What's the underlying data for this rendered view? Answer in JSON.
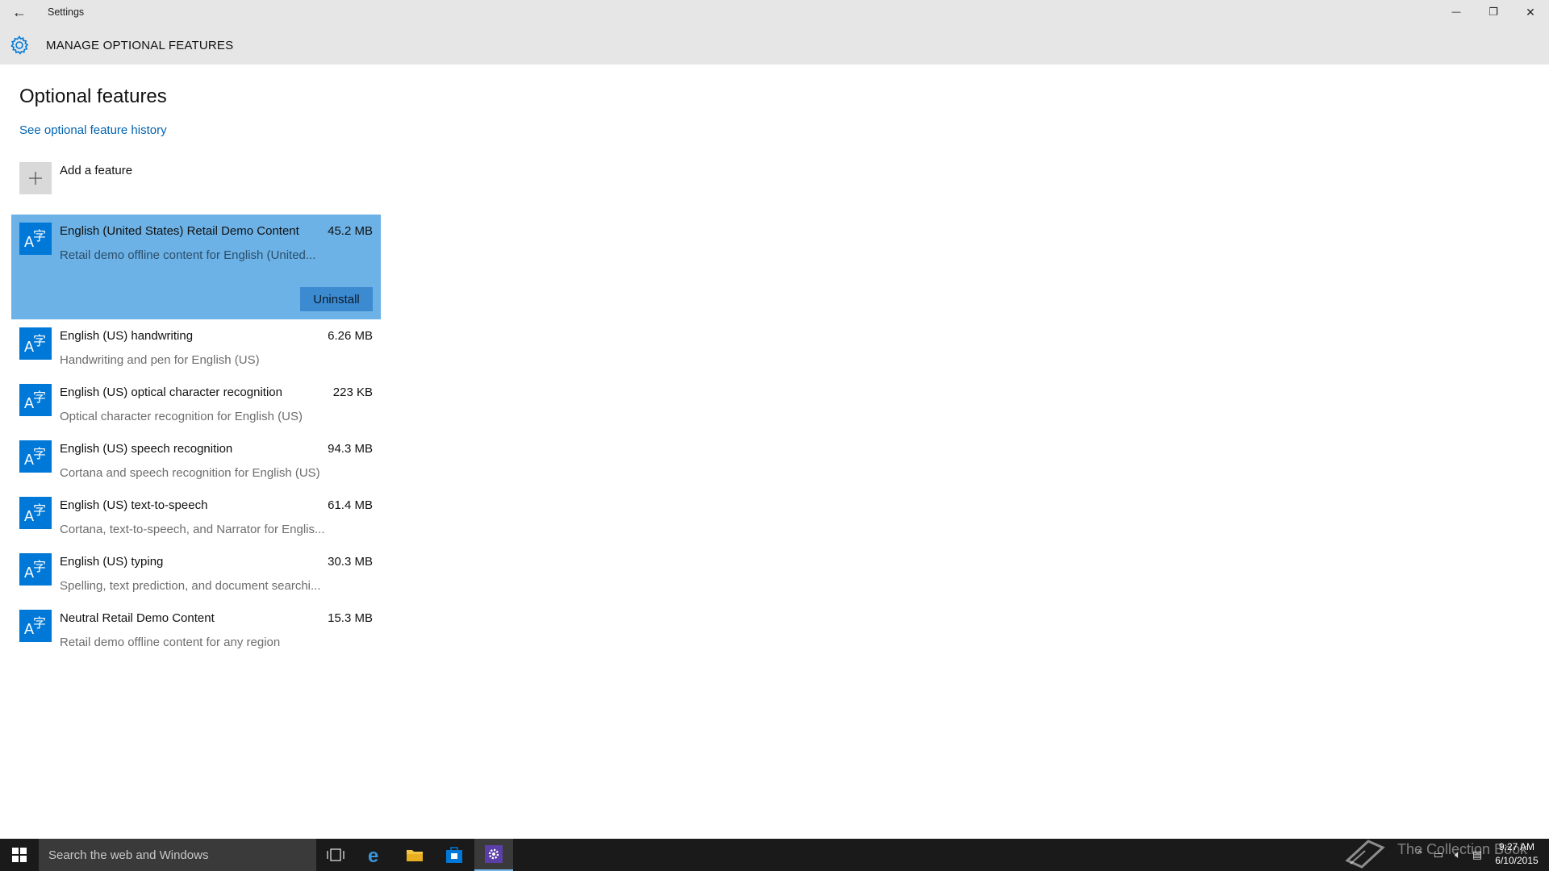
{
  "window": {
    "title": "Settings",
    "back_glyph": "←",
    "minimize_glyph": "—",
    "maximize_glyph": "❐",
    "close_glyph": "✕"
  },
  "header": {
    "title": "MANAGE OPTIONAL FEATURES",
    "icon": "gear-icon",
    "icon_color": "#0078d7"
  },
  "main": {
    "heading": "Optional features",
    "history_link": "See optional feature history",
    "add_feature_label": "Add a feature",
    "features": [
      {
        "name": "English (United States) Retail Demo Content",
        "size": "45.2 MB",
        "description": "Retail demo offline content for English (United...",
        "selected": true,
        "action": "Uninstall"
      },
      {
        "name": "English (US) handwriting",
        "size": "6.26 MB",
        "description": "Handwriting and pen for English (US)"
      },
      {
        "name": "English (US) optical character recognition",
        "size": "223 KB",
        "description": "Optical character recognition for English (US)"
      },
      {
        "name": "English (US) speech recognition",
        "size": "94.3 MB",
        "description": "Cortana and speech recognition for English (US)"
      },
      {
        "name": "English (US) text-to-speech",
        "size": "61.4 MB",
        "description": "Cortana, text-to-speech, and Narrator for Englis..."
      },
      {
        "name": "English (US) typing",
        "size": "30.3 MB",
        "description": "Spelling, text prediction, and document searchi..."
      },
      {
        "name": "Neutral Retail Demo Content",
        "size": "15.3 MB",
        "description": "Retail demo offline content for any region"
      }
    ]
  },
  "colors": {
    "accent": "#0078d7",
    "selected_bg": "#6cb2e6",
    "link": "#0063b1",
    "taskbar": "#1a1a1a"
  },
  "taskbar": {
    "search_placeholder": "Search the web and Windows",
    "apps": [
      "task-view-icon",
      "edge-icon",
      "file-explorer-icon",
      "store-icon",
      "settings-icon"
    ],
    "watermark": "The Collection Book",
    "clock_time": "9:27 AM",
    "clock_date": "6/10/2015"
  }
}
